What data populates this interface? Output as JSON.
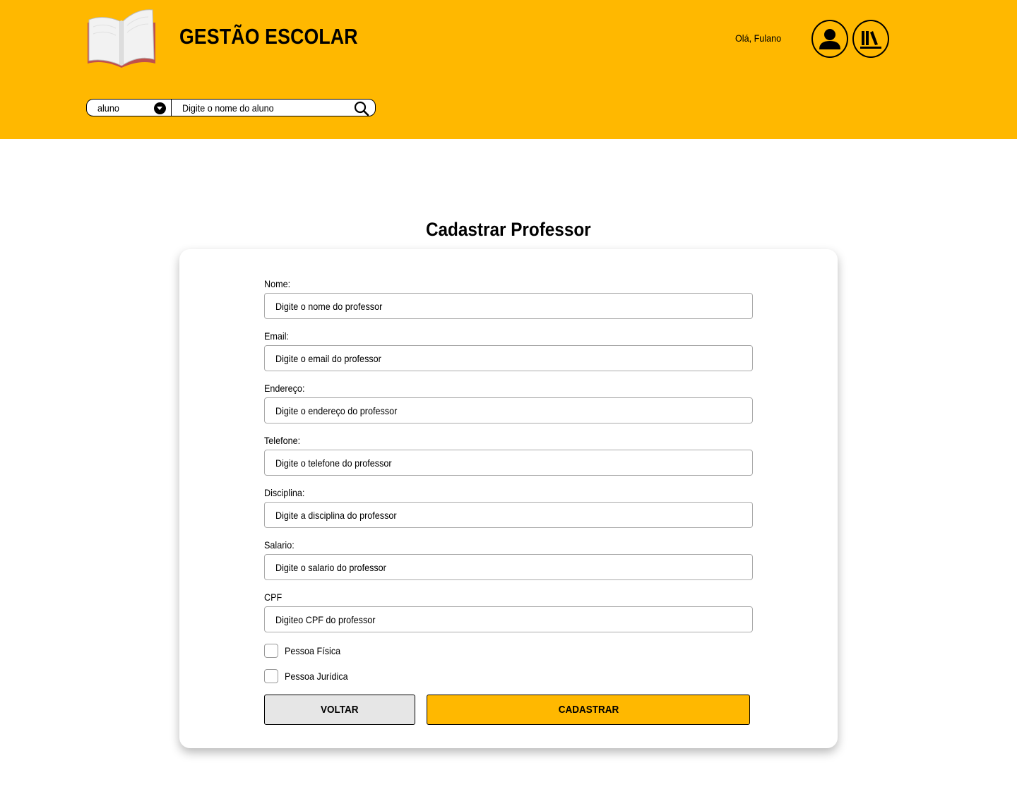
{
  "header": {
    "app_title": "GESTÃO ESCOLAR",
    "greeting": "Olá, Fulano",
    "accent_color": "#ffb800",
    "icons": [
      "open-book-logo",
      "user-icon",
      "books-icon"
    ]
  },
  "search": {
    "type_selected": "aluno",
    "placeholder": "Digite o nome do aluno"
  },
  "page": {
    "title": "Cadastrar Professor"
  },
  "form": {
    "fields": [
      {
        "label": "Nome:",
        "placeholder": "Digite o nome do professor"
      },
      {
        "label": "Email:",
        "placeholder": "Digite o email do professor"
      },
      {
        "label": "Endereço:",
        "placeholder": "Digite o endereço do professor"
      },
      {
        "label": "Telefone:",
        "placeholder": "Digite o telefone do professor"
      },
      {
        "label": "Disciplina:",
        "placeholder": "Digite a disciplina do professor"
      },
      {
        "label": "Salario:",
        "placeholder": "Digite o salario do professor"
      },
      {
        "label": "CPF",
        "placeholder": "Digiteo CPF do professor"
      }
    ],
    "checkboxes": [
      {
        "label": "Pessoa Física",
        "checked": false
      },
      {
        "label": "Pessoa Jurídica",
        "checked": false
      }
    ],
    "back_label": "VOLTAR",
    "submit_label": "CADASTRAR"
  }
}
